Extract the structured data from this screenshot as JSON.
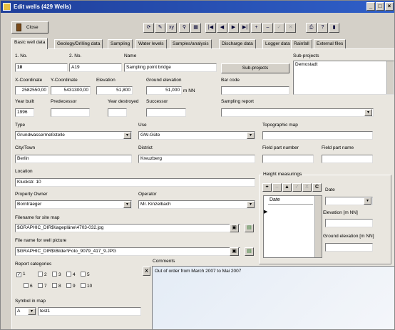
{
  "window": {
    "title": "Edit wells  (429 Wells)"
  },
  "toolbar": {
    "close_label": "Close",
    "xy_label": "xy",
    "nav_icons": [
      "|◀",
      "◀",
      "▶",
      "▶|",
      "+",
      "–",
      "✓",
      "X"
    ]
  },
  "tabs": [
    "Basic well data",
    "Geology/Drilling data",
    "Sampling",
    "Water levels",
    "Samples/analysis",
    "Discharge data",
    "Logger data",
    "Rainfall",
    "External files"
  ],
  "fields": {
    "no1": {
      "label": "1. No.",
      "value": "10"
    },
    "no2": {
      "label": "2. No.",
      "value": "A19"
    },
    "name": {
      "label": "Name",
      "value": "Sampling point bridge"
    },
    "subprojects_button": "Sub-projects",
    "subprojects": {
      "label": "Sub-projects",
      "value": "Demostadt"
    },
    "xcoord": {
      "label": "X-Coordinate",
      "value": "2582550,00"
    },
    "ycoord": {
      "label": "Y-Coordinate",
      "value": "5431300,00"
    },
    "elevation": {
      "label": "Elevation",
      "value": "51,800"
    },
    "ground_elevation": {
      "label": "Ground elevation",
      "value": "51,000",
      "unit": "m NN"
    },
    "bar_code": {
      "label": "Bar code",
      "value": ""
    },
    "year_built": {
      "label": "Year built",
      "value": "1996"
    },
    "predecessor": {
      "label": "Predecessor",
      "value": ""
    },
    "year_destroyed": {
      "label": "Year destroyed",
      "value": ""
    },
    "successor": {
      "label": "Successor",
      "value": ""
    },
    "sampling_report": {
      "label": "Sampling report",
      "value": ""
    },
    "type": {
      "label": "Type",
      "value": "Grundwassermeßstelle"
    },
    "use": {
      "label": "Use",
      "value": "GW-Güte"
    },
    "topographic_map": {
      "label": "Topographic map",
      "value": ""
    },
    "city": {
      "label": "City/Town",
      "value": "Berlin"
    },
    "district": {
      "label": "District",
      "value": "Kreuzberg"
    },
    "field_part_number": {
      "label": "Field part number",
      "value": ""
    },
    "field_part_name": {
      "label": "Field part name",
      "value": ""
    },
    "location": {
      "label": "Location",
      "value": "Kluckstr. 10"
    },
    "owner": {
      "label": "Property Owner",
      "value": "Bornträeger"
    },
    "operator": {
      "label": "Operator",
      "value": "Mr. Kinzelbach"
    },
    "site_map": {
      "label": "Filename for site map",
      "value": "$GRAPHIC_DIR$\\lagepläne\\4703-032.jpg"
    },
    "well_picture": {
      "label": "File name for well picture",
      "value": "$GRAPHIC_DIR$\\Bilder\\Foto_9079_417_9.JPG"
    },
    "report_categories": {
      "label": "Report categories",
      "items": [
        "1",
        "2",
        "3",
        "4",
        "5",
        "6",
        "7",
        "8",
        "9",
        "10"
      ],
      "checked": [
        "1"
      ]
    },
    "symbol": {
      "label": "Symbol in map",
      "value": "A",
      "text": "test1"
    },
    "comments": {
      "label": "Comments",
      "value": "Out of order from March 2007 to Mai 2007",
      "clear": "X"
    }
  },
  "height": {
    "label": "Height measurings",
    "tools": [
      "+",
      "–",
      "▲",
      "✓",
      "X",
      "C"
    ],
    "col": "Date",
    "date_label": "Date",
    "elev_label": "Elevation [m NN]",
    "ground_label": "Ground elevation  [m NN]"
  }
}
